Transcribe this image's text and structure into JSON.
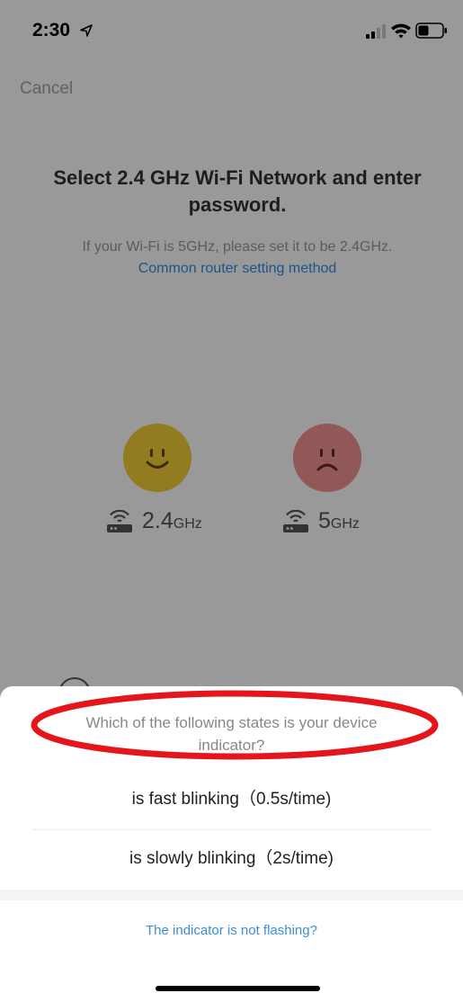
{
  "status_bar": {
    "time": "2:30"
  },
  "background": {
    "cancel_label": "Cancel",
    "card": {
      "title": "Select 2.4 GHz Wi-Fi Network and enter password.",
      "desc_text": "If your Wi-Fi is 5GHz, please set it to be 2.4GHz.",
      "desc_link": "Common router setting method",
      "band_24": {
        "number": "2.4",
        "unit": "GHz"
      },
      "band_5": {
        "number": "5",
        "unit": "GHz"
      }
    }
  },
  "sheet": {
    "question": "Which of the following states is your device indicator?",
    "options": [
      {
        "label": "is fast blinking（0.5s/time)"
      },
      {
        "label": "is slowly blinking（2s/time)"
      }
    ],
    "help_link": "The indicator is not flashing?"
  },
  "colors": {
    "accent_link": "#2f8fe6",
    "happy_face": "#f6cd34",
    "sad_face": "#f39191",
    "highlight_annotation": "#e4151b"
  }
}
